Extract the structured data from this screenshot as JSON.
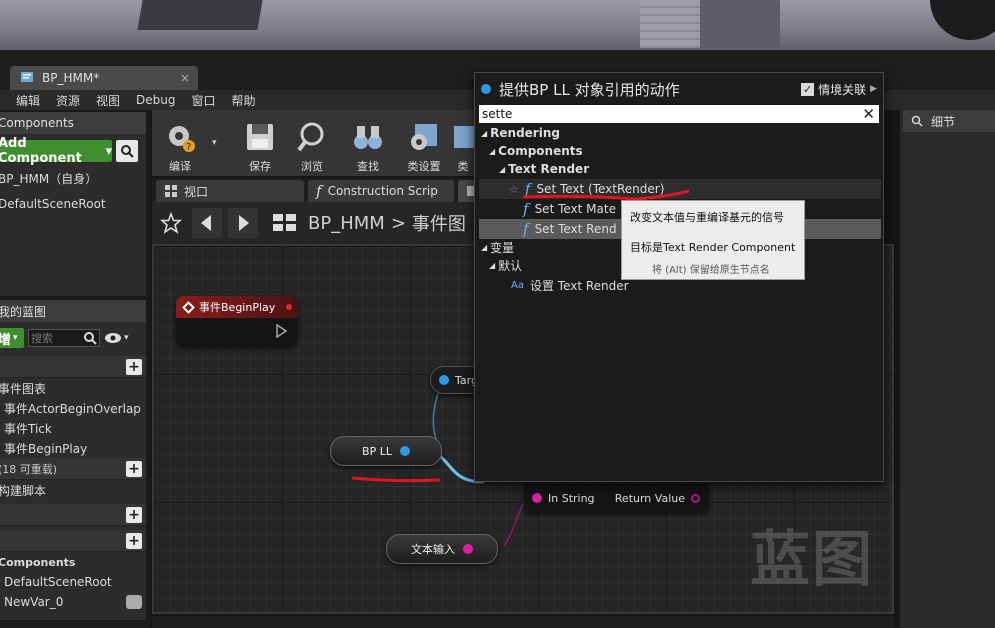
{
  "document_tab": {
    "title": "BP_HMM*",
    "close": "×"
  },
  "menu": [
    "编辑",
    "资源",
    "视图",
    "Debug",
    "窗口",
    "帮助"
  ],
  "components_panel": {
    "title": "Components",
    "add_button": "Add Component",
    "add_button_arrow": "▾",
    "self_item": "BP_HMM（自身）",
    "root_item": "DefaultSceneRoot"
  },
  "my_blueprint_panel": {
    "title": "我的蓝图",
    "add_button": "增",
    "search_placeholder": "搜索",
    "graphs_section": "",
    "event_graph": "事件图表",
    "events": [
      "事件ActorBeginOverlap",
      "事件Tick",
      "事件BeginPlay"
    ],
    "functions_section": "(18 可重载)",
    "construction_script": "构建脚本",
    "variables_label": "Components",
    "var_items": [
      "DefaultSceneRoot",
      "NewVar_0"
    ]
  },
  "toolbar": {
    "buttons": [
      "编译",
      "保存",
      "浏览",
      "查找",
      "类设置",
      "类"
    ]
  },
  "graph_tabs": {
    "viewport": "视口",
    "construction": "Construction Scrip"
  },
  "breadcrumb": {
    "blueprint": "BP_HMM",
    "separator": ">",
    "graph": "事件图"
  },
  "graph": {
    "event_node": "事件BeginPlay",
    "target_pin": "Targ",
    "bp_ll_node": "BP LL",
    "in_string": "In String",
    "return_value": "Return Value",
    "text_input_node": "文本输入",
    "watermark": "蓝图"
  },
  "details_panel": {
    "title": "细节"
  },
  "action_menu": {
    "title": "提供BP LL 对象引用的动作",
    "context_sensitive": "情境关联",
    "context_checked": "✓",
    "search_value": "sette",
    "clear": "✕",
    "tree": [
      {
        "label": "Rendering",
        "level": 0,
        "bold": true,
        "arrow": "◢"
      },
      {
        "label": "Components",
        "level": 1,
        "bold": true,
        "arrow": "◢"
      },
      {
        "label": "Text Render",
        "level": 2,
        "bold": true,
        "arrow": "◢"
      },
      {
        "label": "Set Text (TextRender)",
        "level": 3,
        "bold": false,
        "icon": "f",
        "star": "☆",
        "selected": false
      },
      {
        "label": "Set Text Mate",
        "level": 3,
        "bold": false,
        "icon": "f"
      },
      {
        "label": "Set Text Rend",
        "level": 3,
        "bold": false,
        "icon": "f",
        "selected": true
      },
      {
        "label": "变量",
        "level": 0,
        "bold": false,
        "arrow": "◢"
      },
      {
        "label": "默认",
        "level": 1,
        "bold": false,
        "arrow": "◢"
      },
      {
        "label": "设置 Text Render",
        "level": 2,
        "bold": false,
        "icon": "Aa"
      }
    ]
  },
  "tooltip": {
    "line1": "改变文本值与重编译基元的信号",
    "line2": "目标是Text Render Component",
    "line3": "将 (Alt) 保留给原生节点名"
  },
  "colors": {
    "add_green": "#3f8f2f",
    "annotation_red": "#e0141e",
    "pin_blue": "#2e9ae6",
    "pin_magenta": "#e01ea6"
  }
}
